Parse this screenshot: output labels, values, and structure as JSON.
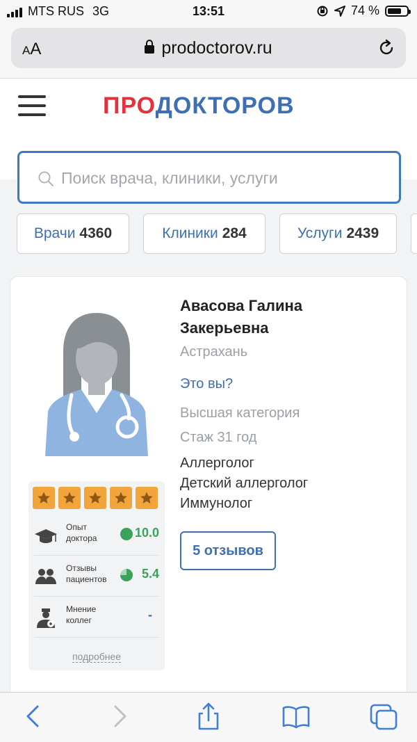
{
  "status_bar": {
    "carrier": "MTS RUS",
    "network": "3G",
    "time": "13:51",
    "battery_pct": "74 %",
    "battery_level": 0.74
  },
  "browser": {
    "aa_small": "A",
    "aa_large": "A",
    "url": "prodoctorov.ru"
  },
  "header": {
    "logo_part1": "ПРО",
    "logo_part2": "ДОКТОРОВ"
  },
  "search": {
    "placeholder": "Поиск врача, клиники, услуги"
  },
  "filters": [
    {
      "label": "Врачи",
      "count": "4360"
    },
    {
      "label": "Клиники",
      "count": "284"
    },
    {
      "label": "Услуги",
      "count": "2439"
    }
  ],
  "doctor": {
    "name": "Авасова Галина Закерьевна",
    "city": "Астрахань",
    "claim_link": "Это вы?",
    "category": "Высшая категория",
    "experience": "Стаж 31 год",
    "specialties": [
      "Аллерголог",
      "Детский аллерголог",
      "Иммунолог"
    ],
    "reviews_button": "5 отзывов"
  },
  "rating": {
    "stars": 5,
    "rows": [
      {
        "label": "Опыт доктора",
        "value": "10.0",
        "icon": "graduation-cap-icon",
        "level": 1.0
      },
      {
        "label": "Отзывы пациентов",
        "value": "5.4",
        "icon": "patients-icon",
        "level": 0.75
      },
      {
        "label": "Мнение коллег",
        "value": "-",
        "icon": "doctor-icon"
      }
    ],
    "more_link": "подробнее"
  },
  "colors": {
    "accent": "#3f6fb3",
    "logo_red": "#e0333c",
    "star": "#f2a53a",
    "score_green": "#3aa35a"
  }
}
